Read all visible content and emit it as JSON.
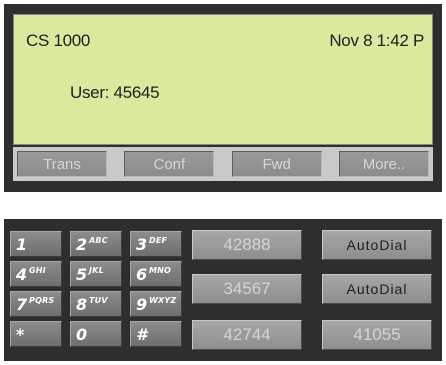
{
  "display": {
    "title": "CS 1000",
    "datetime": "Nov 8  1:42 P",
    "user": "User: 45645"
  },
  "softkeys": [
    {
      "label": "Trans"
    },
    {
      "label": "Conf"
    },
    {
      "label": "Fwd"
    },
    {
      "label": "More.."
    }
  ],
  "dialpad": [
    {
      "digit": "1",
      "letters": ""
    },
    {
      "digit": "2",
      "letters": "ABC"
    },
    {
      "digit": "3",
      "letters": "DEF"
    },
    {
      "digit": "4",
      "letters": "GHI"
    },
    {
      "digit": "5",
      "letters": "JKL"
    },
    {
      "digit": "6",
      "letters": "MNO"
    },
    {
      "digit": "7",
      "letters": "PQRS"
    },
    {
      "digit": "8",
      "letters": "TUV"
    },
    {
      "digit": "9",
      "letters": "WXYZ"
    },
    {
      "digit": "*",
      "letters": ""
    },
    {
      "digit": "0",
      "letters": ""
    },
    {
      "digit": "#",
      "letters": ""
    }
  ],
  "speed_dial": {
    "col_a": [
      "42888",
      "34567",
      "42744"
    ],
    "col_b": [
      "AutoDial",
      "AutoDial",
      "41055"
    ]
  },
  "colors": {
    "lcd_background": "#d9e99e",
    "panel_frame": "#2e2e2e",
    "softkey_bar": "#c9c9c9"
  }
}
